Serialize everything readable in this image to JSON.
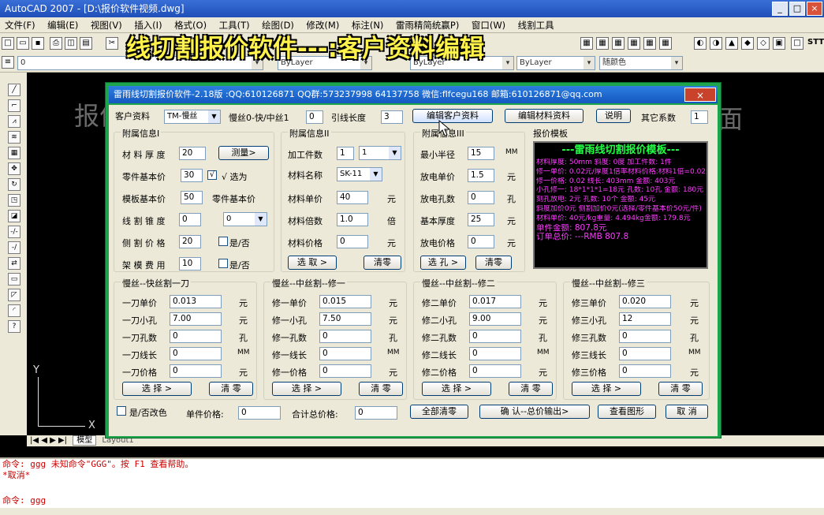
{
  "window": {
    "title": "AutoCAD 2007 - [D:\\报价软件视频.dwg]",
    "min": "_",
    "max": "□",
    "close": "×"
  },
  "menus": [
    "文件(F)",
    "编辑(E)",
    "视图(V)",
    "插入(I)",
    "格式(O)",
    "工具(T)",
    "绘图(D)",
    "修改(M)",
    "标注(N)",
    "雷雨精简统赢P)",
    "窗口(W)",
    "线割工具"
  ],
  "layer": {
    "current": "0",
    "linetype": "ByLayer",
    "lineweight": "ByLayer",
    "plotstyle": "ByLayer",
    "color": "随颜色",
    "stt": "STT"
  },
  "banner": "线切割报价软件---:客户资料编辑",
  "canvas": {
    "ghost_left": "报价",
    "ghost_right": "面",
    "axis_y": "Y",
    "axis_x": "X"
  },
  "tabs": {
    "model": "模型",
    "layout": "Layout1"
  },
  "command": {
    "line1": "命令: ggg  未知命令\"GGG\"。按 F1 查看帮助。",
    "line2": "*取消*",
    "prompt": "命令: ggg"
  },
  "dialog": {
    "title": "雷雨线切割报价软件-2.18版 :QQ:610126871 QQ群:573237998 64137758 微信:flfcegu168 邮箱:610126871@qq.com",
    "close": "×",
    "top": {
      "client_label": "客户资料",
      "client_value": "TM-慢丝",
      "ratio_label": "慢丝0-快/中丝1",
      "ratio_value": "0",
      "lead_label": "引线长度",
      "lead_value": "3",
      "btn_client": "编辑客户资料",
      "btn_material": "编辑材料资料",
      "btn_help": "说明",
      "other_label": "其它系数",
      "other_value": "1"
    },
    "info1": {
      "title": "附属信息I",
      "thickness_label": "材 料 厚 度",
      "thickness": "20",
      "btn_measure": "测量>",
      "base_label": "零件基本价",
      "base": "30",
      "chk_sel": "√",
      "sel_label": "√ 选为",
      "tpl_label": "模板基本价",
      "tpl": "50",
      "part_base_label": "零件基本价",
      "taper_label": "线 割 锥 度",
      "taper": "0",
      "taper_sel": "0",
      "side_label": "侧 割 价 格",
      "side": "20",
      "yn1": "是/否",
      "frame_label": "架 模 费 用",
      "frame": "10",
      "yn2": "是/否"
    },
    "info2": {
      "title": "附属信息II",
      "count_label": "加工件数",
      "count": "1",
      "count_sel": "1",
      "mat_label": "材料名称",
      "mat": "SK-11",
      "unit_label": "材料单价",
      "unit": "40",
      "unit_u": "元",
      "mult_label": "材料倍数",
      "mult": "1.0",
      "mult_u": "倍",
      "price_label": "材料价格",
      "price": "0",
      "price_u": "元",
      "btn_sel": "选 取 >",
      "btn_clr": "清零"
    },
    "info3": {
      "title": "附属信息III",
      "radius_label": "最小半径",
      "radius": "15",
      "radius_u": "MM",
      "edm_label": "放电单价",
      "edm": "1.5",
      "edm_u": "元",
      "holes_label": "放电孔数",
      "holes": "0",
      "holes_u": "孔",
      "base_label": "基本厚度",
      "base": "25",
      "base_u": "元",
      "eprice_label": "放电价格",
      "eprice": "0",
      "eprice_u": "元",
      "btn_sel": "选 孔 >",
      "btn_clr": "清零"
    },
    "quote": {
      "title": "报价模板",
      "heading": "---雷雨线切割报价模板---",
      "lines": [
        "材料厚度: 50mm  斜度: 0度  加工件数: 1件",
        "修一单价: 0.02元/厚度1倍率材料价格:材料1倍=0.02元",
        "修一价格: 0.02  线长: 403mm  金额: 403元",
        "小孔修一: 18*1*1*1=18元  孔数: 10孔  金额: 180元",
        "刻孔放电: 2元  孔数: 10个  金额: 45元",
        "斜度加价0元  侧割加价0元(选择/零件基本价50元/件)",
        "材料单价: 40元/kg重量: 4.494kg金额: 179.8元",
        "单件金额: 807.8元",
        "订单总价: ---RMB 807.8"
      ]
    },
    "s1": {
      "title": "慢丝--快丝割一刀",
      "r1": "一刀单价",
      "v1": "0.013",
      "u1": "元",
      "r2": "一刀小孔",
      "v2": "7.00",
      "u2": "元",
      "r3": "一刀孔数",
      "v3": "0",
      "u3": "孔",
      "r4": "一刀线长",
      "v4": "0",
      "u4": "MM",
      "r5": "一刀价格",
      "v5": "0",
      "u5": "元",
      "sel": "选   择 >",
      "clr": "清  零"
    },
    "s2": {
      "title": "慢丝--中丝割--修一",
      "r1": "修一单价",
      "v1": "0.015",
      "u1": "元",
      "r2": "修一小孔",
      "v2": "7.50",
      "u2": "元",
      "r3": "修一孔数",
      "v3": "0",
      "u3": "孔",
      "r4": "修一线长",
      "v4": "0",
      "u4": "MM",
      "r5": "修一价格",
      "v5": "0",
      "u5": "元",
      "sel": "选   择 >",
      "clr": "清  零"
    },
    "s3": {
      "title": "慢丝--中丝割--修二",
      "r1": "修二单价",
      "v1": "0.017",
      "u1": "元",
      "r2": "修二小孔",
      "v2": "9.00",
      "u2": "元",
      "r3": "修二孔数",
      "v3": "0",
      "u3": "孔",
      "r4": "修二线长",
      "v4": "0",
      "u4": "MM",
      "r5": "修二价格",
      "v5": "0",
      "u5": "元",
      "sel": "选   择 >",
      "clr": "清  零"
    },
    "s4": {
      "title": "慢丝--中丝割--修三",
      "r1": "修三单价",
      "v1": "0.020",
      "u1": "元",
      "r2": "修三小孔",
      "v2": "12",
      "u2": "元",
      "r3": "修三孔数",
      "v3": "0",
      "u3": "孔",
      "r4": "修三线长",
      "v4": "0",
      "u4": "MM",
      "r5": "修三价格",
      "v5": "0",
      "u5": "元",
      "sel": "选   择 >",
      "clr": "清  零"
    },
    "bottom": {
      "color_chk": "是/否改色",
      "single_label": "单件价格:",
      "single": "0",
      "total_label": "合计总价格:",
      "total": "0",
      "btn_clear": "全部清零",
      "btn_ok": "确 认--总价输出>",
      "btn_view": "查看图形",
      "btn_cancel": "取 消"
    }
  },
  "colors": {
    "dialog_frame": "#1ea44c",
    "quote_heading": "#22ff44",
    "quote_text": "#ff3aff",
    "banner": "#fff24a"
  }
}
